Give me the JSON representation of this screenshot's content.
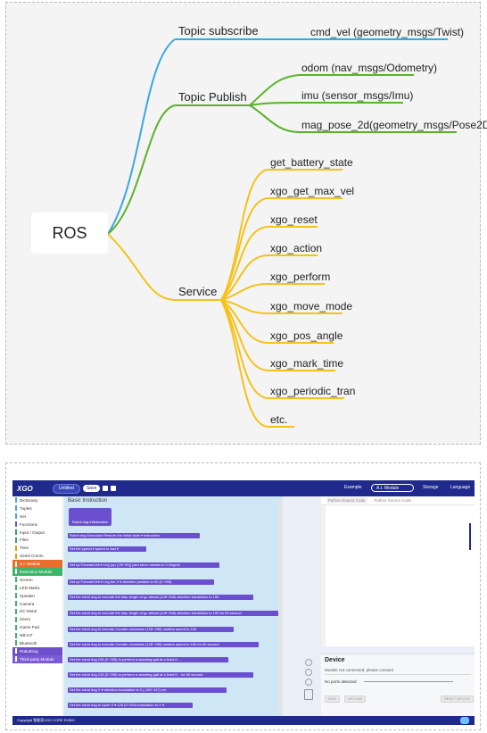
{
  "colors": {
    "subscribe_branch": "#3ba7e0",
    "publish_branch": "#5ab22b",
    "service_branch": "#f5c21b",
    "ide_header": "#1f2a8c",
    "block": "#6a4fcf"
  },
  "mindmap": {
    "root": "ROS",
    "branches": {
      "subscribe": {
        "label": "Topic subscribe",
        "items": [
          "cmd_vel (geometry_msgs/Twist)"
        ]
      },
      "publish": {
        "label": "Topic Publish",
        "items": [
          "odom (nav_msgs/Odometry)",
          "imu (sensor_msgs/Imu)",
          "mag_pose_2d(geometry_msgs/Pose2D)"
        ]
      },
      "service": {
        "label": "Service",
        "items": [
          "get_battery_state",
          "xgo_get_max_vel",
          "xgo_reset",
          "xgo_action",
          "xgo_perform",
          "xgo_move_mode",
          "xgo_pos_angle",
          "xgo_mark_time",
          "xgo_periodic_tran",
          "etc."
        ]
      }
    }
  },
  "ide": {
    "logo": "XGO",
    "project_title": "Untitled",
    "save_label": "Save",
    "example_label": "Example",
    "module_select": "A.I. Module",
    "storage_label": "Storage",
    "language_label": "Language",
    "sidebar": [
      "Dictionary",
      "Tuples",
      "Set",
      "Functions",
      "Input / Output",
      "Files",
      "Time",
      "Serial Comm.",
      "A.I. Module",
      "Extension Module",
      "Screen",
      "LED Matrix",
      "Speaker",
      "Camera",
      "DC Motor",
      "Servo",
      "Game Pad",
      "NB-IoT",
      "Bluetooth",
      "RobotDog",
      "Third-party Module"
    ],
    "workspace": {
      "title": "Basic Instruction",
      "robot_block": "Robot dog initialization",
      "blocks": [
        "Robot dog Execution Restore the initial state ▾ instruction",
        "Set the speed ▾ speed to fast ▾",
        "Set up Forward left ▾ Leg (up (-90~90)) joint servo rotates to 0 Degree",
        "Set up Forward left ▾ Leg toe X ▾ direction position to 50 (0~255)",
        "Set the robot dog to execute the step length of go ahead (128~255) direction translation to 150",
        "Set the robot dog to execute the step length of go ahead (128~255) direction translation to 150 for 60 second",
        "Set the robot dog to execute Counter-clockwise (128~255) rotation speed to 150",
        "Set the robot dog to execute Counter-clockwise (128~255) rotation speed to 150 for 60 second",
        "Set the robot dog 128 (0~255) to perform a standing gait at a fixed fr...",
        "Set the robot dog 128 (0~255) to perform a standing gait at a fixed fr... for 60 second",
        "Set the robot dog X ▾ direction translation to 0 (-128~127) cm",
        "Set the robot dog to cycle X ▾ 125 (0~255) translation to X ▾"
      ]
    },
    "code": {
      "tab_active": "Python Source Code",
      "tab_inactive": "Python Source Code"
    },
    "device": {
      "title": "Device",
      "status": "Module not connected, please connect",
      "ports": "No ports detected",
      "run": "RUN",
      "upload": "UPLOAD",
      "reset": "RESET DEVICE"
    },
    "footer": "Copyright 智能家XGO CORE ROBO"
  }
}
